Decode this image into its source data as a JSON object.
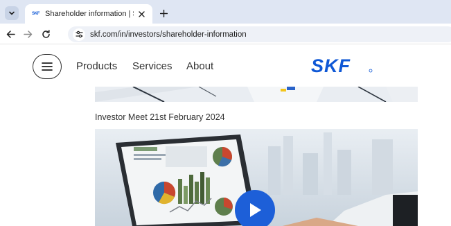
{
  "browser": {
    "tab_title": "Shareholder information | SKF |",
    "tab_favicon_text": "SKF",
    "url": "skf.com/in/investors/shareholder-information",
    "icons": [
      "tab-search-icon",
      "close-icon",
      "plus-icon",
      "back-arrow-icon",
      "forward-arrow-icon",
      "reload-icon",
      "site-info-icon"
    ]
  },
  "nav": {
    "links": [
      "Products",
      "Services",
      "About"
    ],
    "logo_text": "SKF",
    "icons": [
      "hamburger-menu-icon"
    ]
  },
  "content": {
    "video_caption": "Investor Meet 21st February 2024",
    "icons": [
      "play-icon"
    ]
  },
  "colors": {
    "brand_blue": "#0f58d6",
    "play_button": "#1d5fd8",
    "tabstrip": "#dfe6f3"
  }
}
